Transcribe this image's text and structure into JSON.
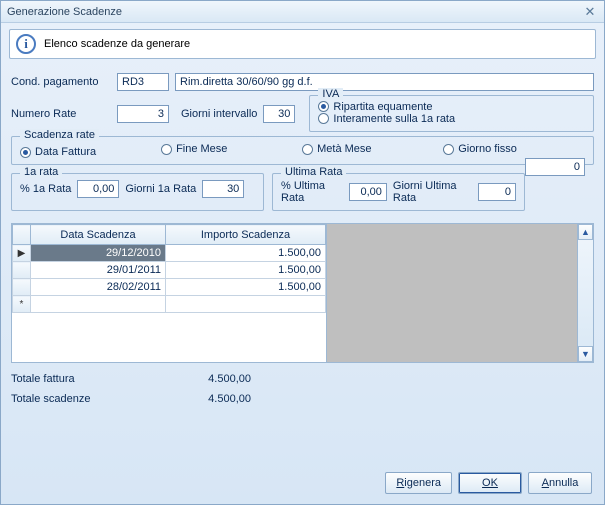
{
  "window": {
    "title": "Generazione Scadenze"
  },
  "info": {
    "text": "Elenco scadenze da generare"
  },
  "payment": {
    "label": "Cond. pagamento",
    "code": "RD3",
    "description": "Rim.diretta 30/60/90 gg d.f."
  },
  "rates": {
    "num_label": "Numero Rate",
    "num_value": "3",
    "interval_label": "Giorni intervallo",
    "interval_value": "30"
  },
  "iva": {
    "legend": "IVA",
    "equal": "Ripartita equamente",
    "first": "Interamente sulla 1a rata",
    "selected": "equal"
  },
  "scadenza_rate": {
    "legend": "Scadenza rate",
    "opt1": "Data Fattura",
    "opt2": "Fine Mese",
    "opt3": "Metà Mese",
    "opt4": "Giorno fisso",
    "fixed_day": "0",
    "selected": "opt1"
  },
  "first_rate": {
    "legend": "1a rata",
    "pct_label": "% 1a  Rata",
    "pct_value": "0,00",
    "days_label": "Giorni 1a Rata",
    "days_value": "30"
  },
  "last_rate": {
    "legend": "Ultima Rata",
    "pct_label": "% Ultima Rata",
    "pct_value": "0,00",
    "days_label": "Giorni Ultima Rata",
    "days_value": "0"
  },
  "grid": {
    "col1": "Data Scadenza",
    "col2": "Importo Scadenza",
    "rows": [
      {
        "date": "29/12/2010",
        "amount": "1.500,00",
        "selected": true
      },
      {
        "date": "29/01/2011",
        "amount": "1.500,00",
        "selected": false
      },
      {
        "date": "28/02/2011",
        "amount": "1.500,00",
        "selected": false
      }
    ]
  },
  "totals": {
    "invoice_label": "Totale fattura",
    "invoice_value": "4.500,00",
    "due_label": "Totale scadenze",
    "due_value": "4.500,00"
  },
  "buttons": {
    "regen": "Rigenera",
    "ok": "OK",
    "cancel": "Annulla"
  }
}
